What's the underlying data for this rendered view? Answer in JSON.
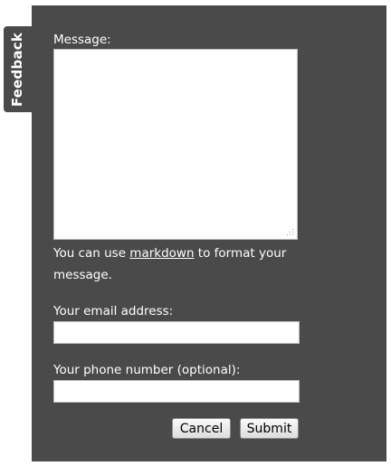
{
  "feedback_tab": {
    "label": "Feedback"
  },
  "form": {
    "message_label": "Message:",
    "message_value": "",
    "hint_before": "You can use ",
    "hint_link": "markdown",
    "hint_after": " to format your message.",
    "email_label": "Your email address:",
    "email_value": "",
    "phone_label": "Your phone number (optional):",
    "phone_value": "",
    "cancel_label": "Cancel",
    "submit_label": "Submit"
  },
  "colors": {
    "panel_background": "#4a4a4a",
    "text": "#ffffff"
  },
  "icons": {
    "resize_grip": "resize-grip-icon"
  }
}
